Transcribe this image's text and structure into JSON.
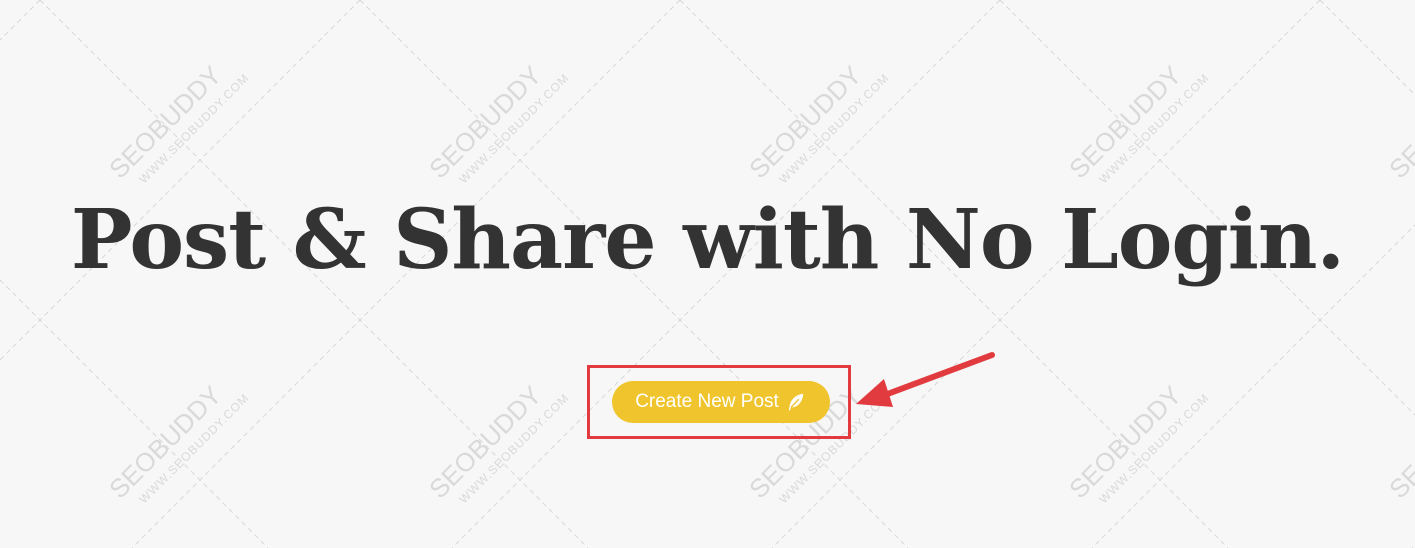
{
  "hero": {
    "title": "Post & Share with No Login."
  },
  "cta": {
    "label": "Create New Post",
    "icon": "feather-icon"
  },
  "annotation": {
    "arrow_icon": "red-arrow-icon"
  },
  "watermark": {
    "brand": "SEOBUDDY",
    "url": "WWW.SEOBUDDY.COM"
  },
  "colors": {
    "background": "#f7f7f7",
    "title": "#333333",
    "button": "#f0c42c",
    "button_text": "#ffffff",
    "annotation": "#e23b3f"
  }
}
